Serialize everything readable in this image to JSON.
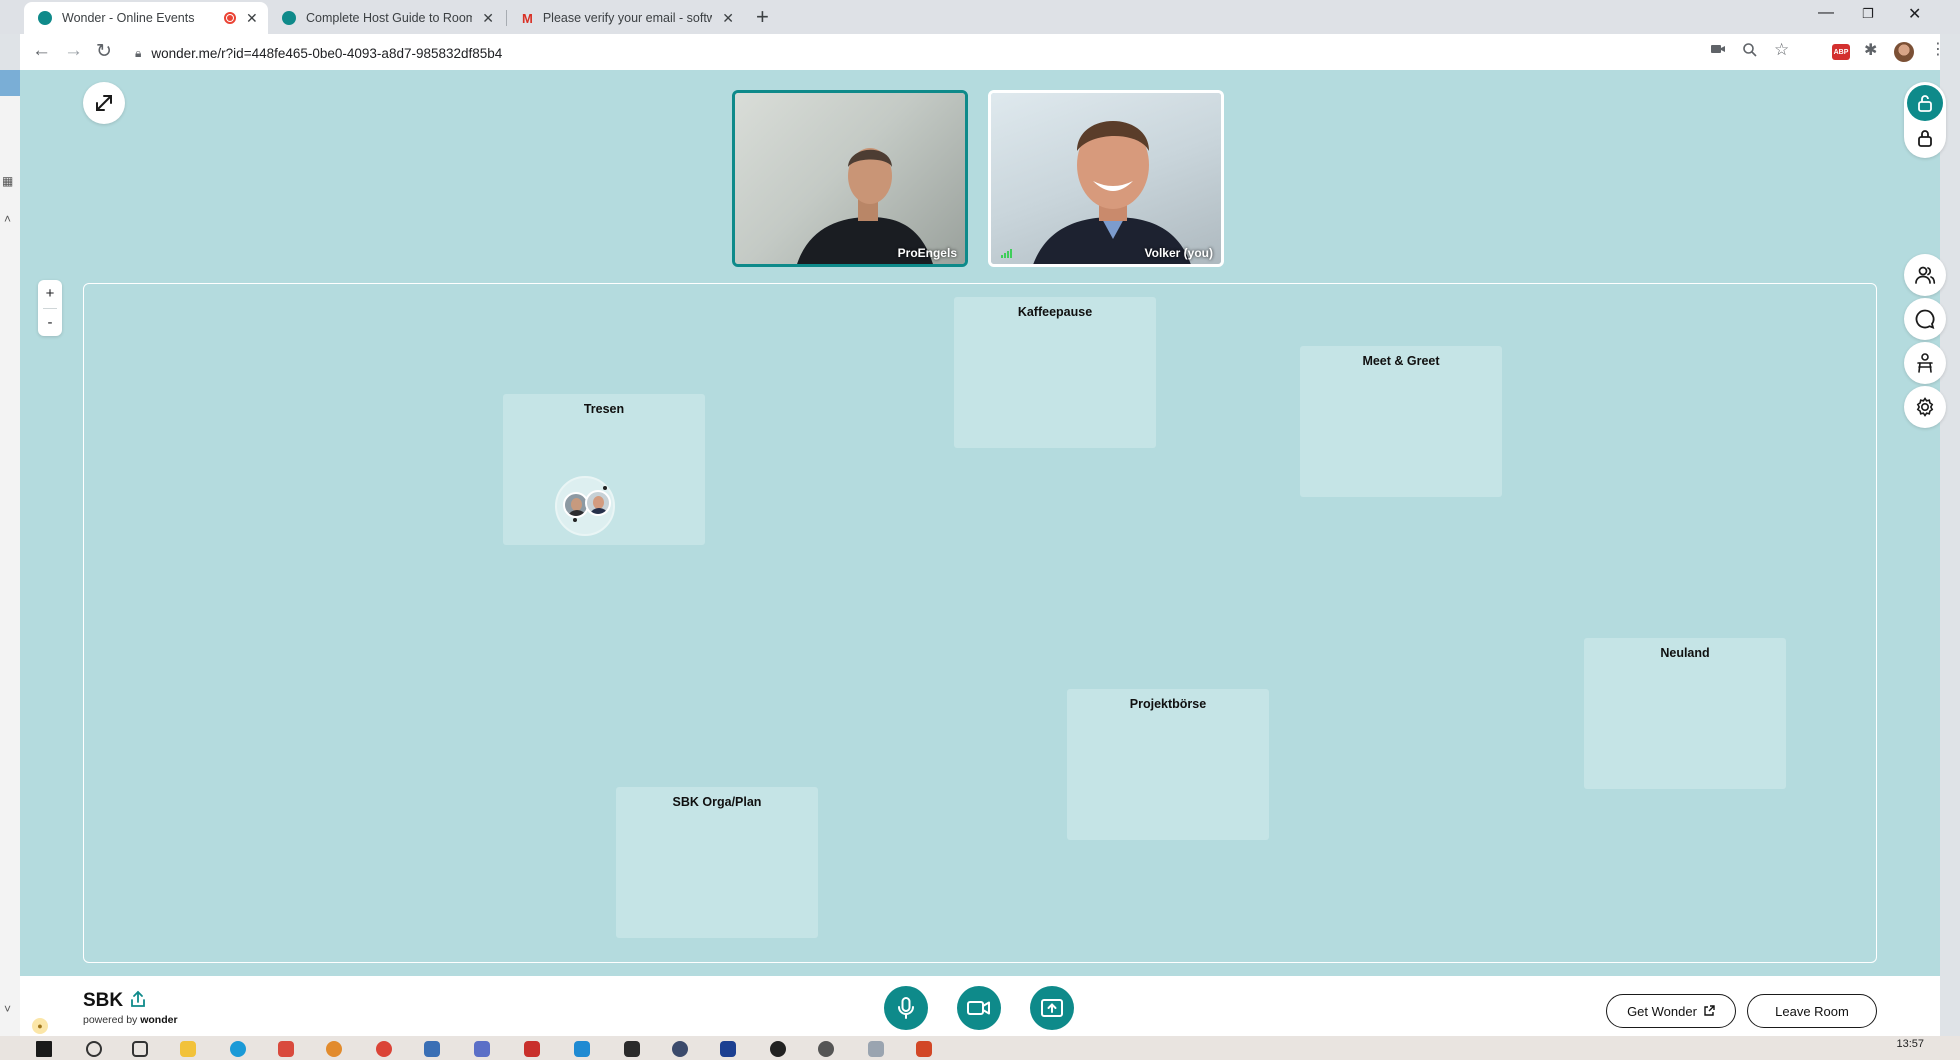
{
  "browser": {
    "tabs": [
      {
        "title": "Wonder - Online Events",
        "active": true,
        "recording": true
      },
      {
        "title": "Complete Host Guide to Room C",
        "active": false
      },
      {
        "title": "Please verify your email - softwar",
        "active": false
      }
    ],
    "url": "wonder.me/r?id=448fe465-0be0-4093-a8d7-985832df85b4"
  },
  "videos": [
    {
      "name": "ProEngels",
      "active": true
    },
    {
      "name": "Volker (you)",
      "active": false
    }
  ],
  "zoom": {
    "in_label": "+",
    "out_label": "-"
  },
  "rooms": [
    {
      "name": "Kaffeepause"
    },
    {
      "name": "Meet & Greet"
    },
    {
      "name": "Tresen"
    },
    {
      "name": "Projektbörse"
    },
    {
      "name": "Neuland"
    },
    {
      "name": "SBK Orga/Plan"
    }
  ],
  "space": {
    "name": "SBK",
    "powered_prefix": "powered by",
    "powered_brand": "wonder"
  },
  "buttons": {
    "get_wonder": "Get Wonder",
    "leave_room": "Leave Room"
  },
  "taskbar": {
    "time": "13:57"
  },
  "colors": {
    "accent": "#0e8a8a",
    "canvas": "#b4dbde",
    "room": "#c5e4e6"
  }
}
